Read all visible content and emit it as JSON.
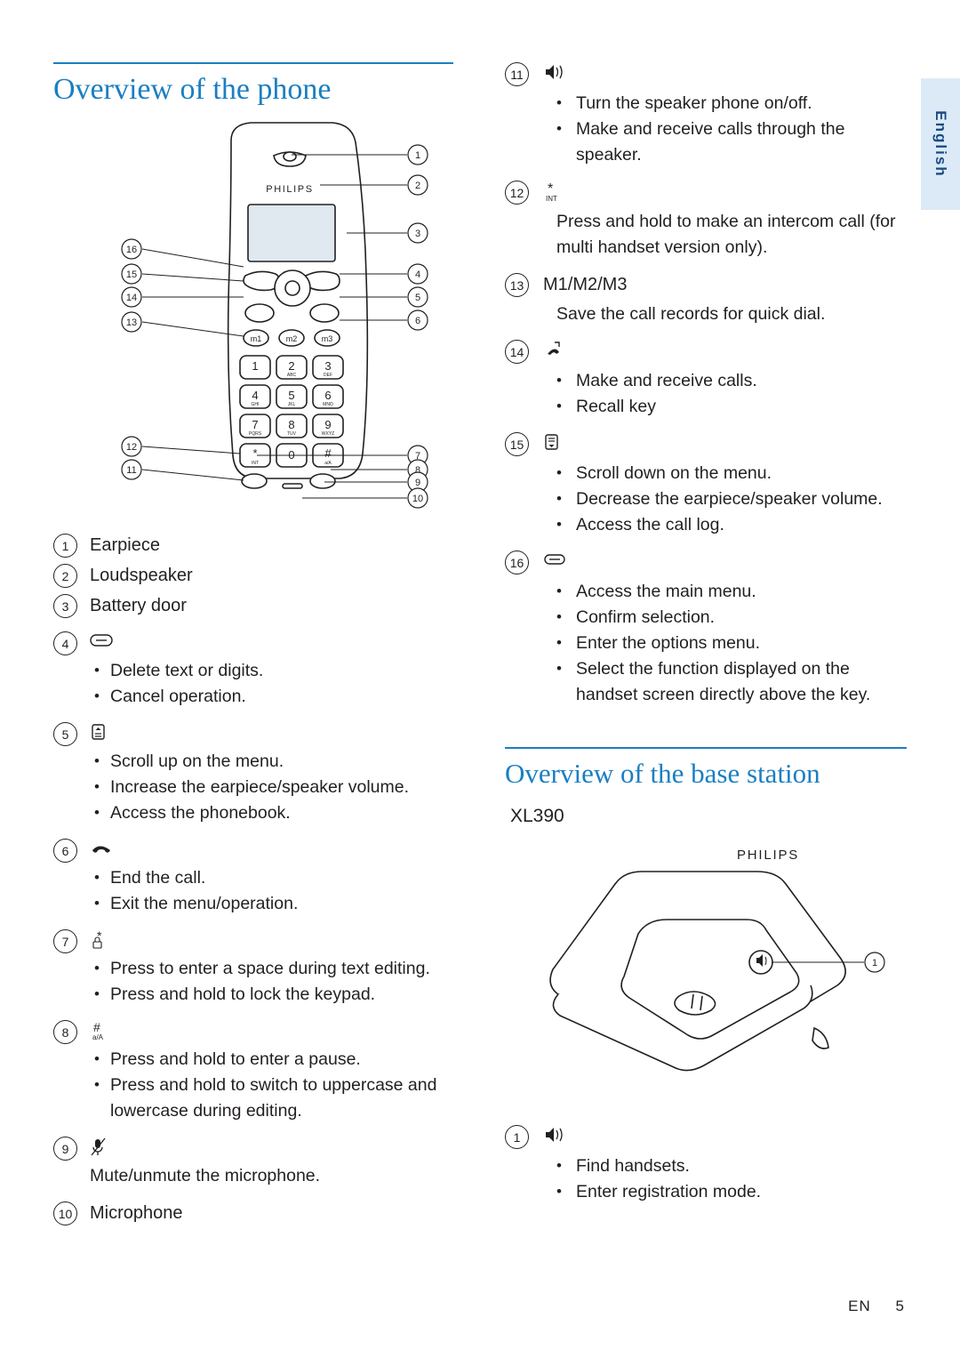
{
  "side_tab": {
    "label": "English"
  },
  "left": {
    "title": "Overview of the phone",
    "items": [
      {
        "num": "1",
        "label": "Earpiece",
        "icon": "",
        "bullets": []
      },
      {
        "num": "2",
        "label": "Loudspeaker",
        "icon": "",
        "bullets": []
      },
      {
        "num": "3",
        "label": "Battery door",
        "icon": "",
        "bullets": []
      },
      {
        "num": "4",
        "label": "",
        "icon": "clear-key-icon",
        "bullets": [
          "Delete text or digits.",
          "Cancel operation."
        ]
      },
      {
        "num": "5",
        "label": "",
        "icon": "up-phonebook-key-icon",
        "bullets": [
          "Scroll up on the menu.",
          "Increase the earpiece/speaker volume.",
          "Access the phonebook."
        ]
      },
      {
        "num": "6",
        "label": "",
        "icon": "end-call-key-icon",
        "bullets": [
          "End the call.",
          "Exit the menu/operation."
        ]
      },
      {
        "num": "7",
        "label": "",
        "icon": "star-lock-key-icon",
        "bullets": [
          "Press to enter a space during text editing.",
          "Press and hold to lock the keypad."
        ]
      },
      {
        "num": "8",
        "label": "",
        "icon": "hash-aA-key-icon",
        "bullets": [
          "Press and hold to enter a pause.",
          "Press and hold to switch to uppercase and lowercase during editing."
        ]
      },
      {
        "num": "9",
        "label": "",
        "icon": "mute-microphone-icon",
        "plain": "Mute/unmute the microphone.",
        "bullets": []
      },
      {
        "num": "10",
        "label": "Microphone",
        "icon": "",
        "bullets": []
      }
    ]
  },
  "right": {
    "items": [
      {
        "num": "11",
        "label": "",
        "icon": "speakerphone-icon",
        "bullets": [
          "Turn the speaker phone on/off.",
          "Make and receive calls through the speaker."
        ]
      },
      {
        "num": "12",
        "label": "",
        "icon": "star-int-key-icon",
        "plain": "Press and hold to make an intercom call (for multi handset version only).",
        "bullets": []
      },
      {
        "num": "13",
        "label": "M1/M2/M3",
        "icon": "",
        "plain": "Save the call records for quick dial.",
        "bullets": []
      },
      {
        "num": "14",
        "label": "",
        "icon": "call-recall-key-icon",
        "bullets": [
          "Make and receive calls.",
          "Recall key"
        ]
      },
      {
        "num": "15",
        "label": "",
        "icon": "down-calllog-key-icon",
        "bullets": [
          "Scroll down on the menu.",
          "Decrease the earpiece/speaker volume.",
          "Access the call log."
        ]
      },
      {
        "num": "16",
        "label": "",
        "icon": "menu-key-icon",
        "bullets": [
          "Access the main menu.",
          "Confirm selection.",
          "Enter the options menu.",
          "Select the function displayed on the handset screen directly above the key."
        ]
      }
    ],
    "base_title": "Overview of the base station",
    "base_model": "XL390",
    "base_items": [
      {
        "num": "1",
        "label": "",
        "icon": "paging-key-icon",
        "bullets": [
          "Find handsets.",
          "Enter registration mode."
        ]
      }
    ]
  },
  "figures": {
    "handset": {
      "brand": "PHILIPS",
      "callouts": [
        "1",
        "2",
        "3",
        "4",
        "5",
        "6",
        "7",
        "8",
        "9",
        "10",
        "11",
        "12",
        "13",
        "14",
        "15",
        "16"
      ],
      "keys": [
        {
          "label": "m1"
        },
        {
          "label": "m2"
        },
        {
          "label": "m3"
        },
        {
          "label": "1",
          "sub": ""
        },
        {
          "label": "2",
          "sub": "ABC"
        },
        {
          "label": "3",
          "sub": "DEF"
        },
        {
          "label": "4",
          "sub": "GHI"
        },
        {
          "label": "5",
          "sub": "JKL"
        },
        {
          "label": "6",
          "sub": "MNO"
        },
        {
          "label": "7",
          "sub": "PQRS"
        },
        {
          "label": "8",
          "sub": "TUV"
        },
        {
          "label": "9",
          "sub": "WXYZ"
        },
        {
          "label": "*",
          "sub": "INT"
        },
        {
          "label": "0",
          "sub": ""
        },
        {
          "label": "#",
          "sub": "a/A"
        }
      ]
    },
    "base": {
      "brand": "PHILIPS",
      "callouts": [
        "1"
      ]
    }
  },
  "footer": {
    "lang": "EN",
    "page": "5"
  }
}
